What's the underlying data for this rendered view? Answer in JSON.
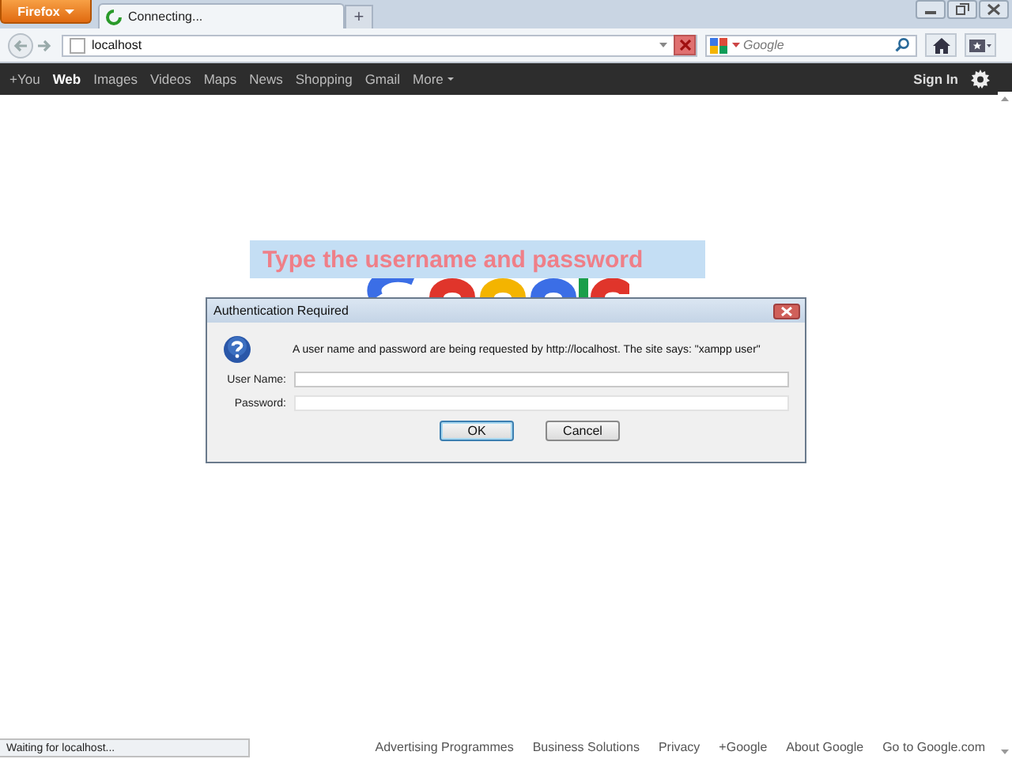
{
  "browser": {
    "menu_button": "Firefox",
    "tabs": [
      {
        "label": "Connecting...",
        "selected": true,
        "loading": true
      }
    ],
    "new_tab": "+",
    "address": "localhost",
    "search": {
      "placeholder": "Google"
    }
  },
  "google_bar": {
    "links": [
      {
        "label": "+You",
        "selected": false
      },
      {
        "label": "Web",
        "selected": true
      },
      {
        "label": "Images",
        "selected": false
      },
      {
        "label": "Videos",
        "selected": false
      },
      {
        "label": "Maps",
        "selected": false
      },
      {
        "label": "News",
        "selected": false
      },
      {
        "label": "Shopping",
        "selected": false
      },
      {
        "label": "Gmail",
        "selected": false
      },
      {
        "label": "More",
        "selected": false,
        "dropdown": true
      }
    ],
    "sign_in": "Sign In"
  },
  "banner": "Type the username and password",
  "dialog": {
    "title": "Authentication Required",
    "message": "A user name and password are being requested by http://localhost. The site says: \"xampp user\"",
    "fields": [
      {
        "label": "User Name:",
        "focused": true
      },
      {
        "label": "Password:",
        "focused": false
      }
    ],
    "buttons": [
      {
        "label": "OK",
        "default": true
      },
      {
        "label": "Cancel",
        "default": false
      }
    ]
  },
  "footer": {
    "links": [
      "Advertising Programmes",
      "Business Solutions",
      "Privacy",
      "+Google",
      "About Google",
      "Go to Google.com"
    ]
  },
  "status_bar": "Waiting for localhost..."
}
